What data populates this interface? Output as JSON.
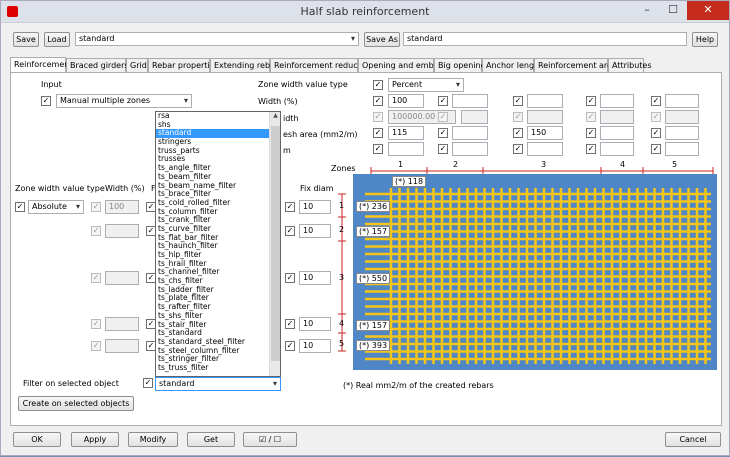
{
  "window": {
    "title": "Half slab reinforcement",
    "min": "–",
    "max": "☐",
    "close": "✕"
  },
  "toolbar": {
    "save": "Save",
    "load": "Load",
    "preset": "standard",
    "save_as": "Save As",
    "save_as_name": "standard",
    "help": "Help"
  },
  "tabs": [
    "Reinforcement",
    "Braced girders",
    "Grid",
    "Rebar properties",
    "Extending rebars",
    "Reinforcement reduction",
    "Opening and embeds",
    "Big openings",
    "Anchor length",
    "Reinforcement areas",
    "Attributes"
  ],
  "left": {
    "input_label": "Input",
    "input_value": "Manual multiple zones",
    "zwvt_label": "Zone width value type",
    "zwvt_value": "Absolute",
    "width_label": "Width (%)",
    "width_value": "100",
    "fix_diam_label": "Fix diam",
    "fix_values": [
      "10",
      "10",
      "10",
      "10",
      "10"
    ],
    "filter_label": "Filter on selected object",
    "filter_value": "standard",
    "create_btn": "Create on selected objects",
    "mesh_label_partial": "esh area (mm2/m)",
    "width_partial": "idth",
    "m_partial": "m",
    "f_partial": "F"
  },
  "right": {
    "zwvt_label": "Zone width value type",
    "zwvt_value": "Percent",
    "width_label": "Width (%)",
    "width_values": [
      "100",
      "",
      "",
      "",
      ""
    ],
    "disabled_value": "100000.00",
    "mesh_values": [
      "115",
      "",
      "150",
      "",
      ""
    ]
  },
  "zones": {
    "label": "Zones",
    "numbers": [
      "1",
      "2",
      "3",
      "4",
      "5"
    ],
    "side_numbers": [
      "1",
      "2",
      "3",
      "4",
      "5"
    ],
    "top_value": "(*) 118",
    "side_values": [
      "(*) 236",
      "(*) 157",
      "(*) 550",
      "(*) 157",
      "(*) 393"
    ],
    "note": "(*) Real mm2/m of the created rebars"
  },
  "dropdown": {
    "items": [
      "rsa",
      "shs",
      "standard",
      "stringers",
      "truss_parts",
      "trusses",
      "ts_angle_filter",
      "ts_beam_filter",
      "ts_beam_name_filter",
      "ts_brace_filter",
      "ts_cold_rolled_filter",
      "ts_column_filter",
      "ts_crank_filter",
      "ts_curve_filter",
      "ts_flat_bar_filter",
      "ts_haunch_filter",
      "ts_hip_filter",
      "ts_hrail_filter",
      "ts_channel_filter",
      "ts_chs_filter",
      "ts_ladder_filter",
      "ts_plate_filter",
      "ts_rafter_filter",
      "ts_shs_filter",
      "ts_stair_filter",
      "ts_standard",
      "ts_standard_steel_filter",
      "ts_steel_column_filter",
      "ts_stringer_filter",
      "ts_truss_filter"
    ],
    "selected": 2
  },
  "bottom": {
    "ok": "OK",
    "apply": "Apply",
    "modify": "Modify",
    "get": "Get",
    "toggle": "☑ / ☐",
    "cancel": "Cancel"
  },
  "colors": {
    "grid_bg": "#4f86c6",
    "rebar": "#f5c518",
    "tick": "#cc2222",
    "selection": "#3399ff"
  }
}
